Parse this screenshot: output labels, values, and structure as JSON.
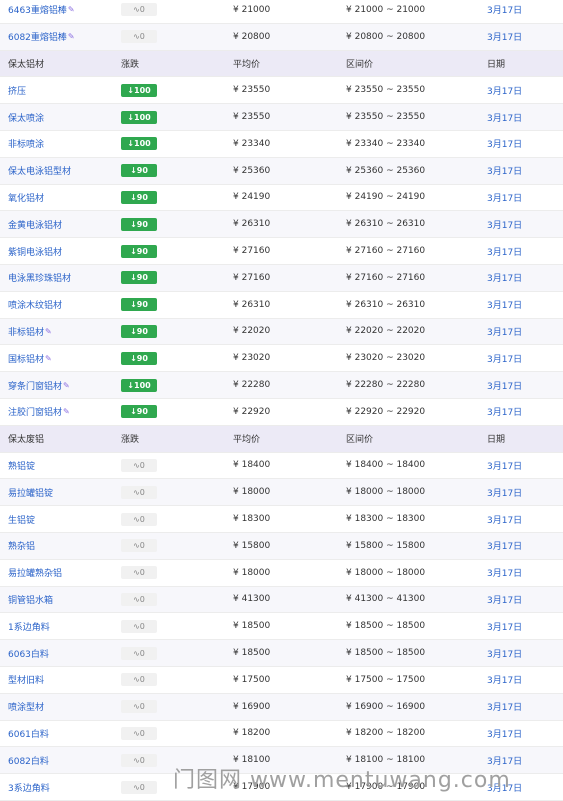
{
  "groups": [
    {
      "header": null,
      "rows": [
        {
          "name": "6463重熔铝棒",
          "pen": true,
          "change": "0",
          "dir": "flat",
          "avg": "¥ 21000",
          "range": "¥ 21000 ~ 21000",
          "date": "3月17日"
        },
        {
          "name": "6082重熔铝棒",
          "pen": true,
          "change": "0",
          "dir": "flat",
          "avg": "¥ 20800",
          "range": "¥ 20800 ~ 20800",
          "date": "3月17日"
        }
      ]
    },
    {
      "header": {
        "name": "保太铝材",
        "change": "涨跌",
        "avg": "平均价",
        "range": "区间价",
        "date": "日期"
      },
      "rows": [
        {
          "name": "挤压",
          "change": "100",
          "dir": "down",
          "avg": "¥ 23550",
          "range": "¥ 23550 ~ 23550",
          "date": "3月17日"
        },
        {
          "name": "保太喷涂",
          "change": "100",
          "dir": "down",
          "avg": "¥ 23550",
          "range": "¥ 23550 ~ 23550",
          "date": "3月17日"
        },
        {
          "name": "非标喷涂",
          "change": "100",
          "dir": "down",
          "avg": "¥ 23340",
          "range": "¥ 23340 ~ 23340",
          "date": "3月17日"
        },
        {
          "name": "保太电泳铝型材",
          "change": "90",
          "dir": "down",
          "avg": "¥ 25360",
          "range": "¥ 25360 ~ 25360",
          "date": "3月17日"
        },
        {
          "name": "氧化铝材",
          "change": "90",
          "dir": "down",
          "avg": "¥ 24190",
          "range": "¥ 24190 ~ 24190",
          "date": "3月17日"
        },
        {
          "name": "金黄电泳铝材",
          "change": "90",
          "dir": "down",
          "avg": "¥ 26310",
          "range": "¥ 26310 ~ 26310",
          "date": "3月17日"
        },
        {
          "name": "紫铜电泳铝材",
          "change": "90",
          "dir": "down",
          "avg": "¥ 27160",
          "range": "¥ 27160 ~ 27160",
          "date": "3月17日"
        },
        {
          "name": "电泳黑珍珠铝材",
          "change": "90",
          "dir": "down",
          "avg": "¥ 27160",
          "range": "¥ 27160 ~ 27160",
          "date": "3月17日"
        },
        {
          "name": "喷涂木纹铝材",
          "change": "90",
          "dir": "down",
          "avg": "¥ 26310",
          "range": "¥ 26310 ~ 26310",
          "date": "3月17日"
        },
        {
          "name": "非标铝材",
          "pen": true,
          "change": "90",
          "dir": "down",
          "avg": "¥ 22020",
          "range": "¥ 22020 ~ 22020",
          "date": "3月17日"
        },
        {
          "name": "国标铝材",
          "pen": true,
          "change": "90",
          "dir": "down",
          "avg": "¥ 23020",
          "range": "¥ 23020 ~ 23020",
          "date": "3月17日"
        },
        {
          "name": "穿条门窗铝材",
          "pen": true,
          "change": "100",
          "dir": "down",
          "avg": "¥ 22280",
          "range": "¥ 22280 ~ 22280",
          "date": "3月17日"
        },
        {
          "name": "注胶门窗铝材",
          "pen": true,
          "change": "90",
          "dir": "down",
          "avg": "¥ 22920",
          "range": "¥ 22920 ~ 22920",
          "date": "3月17日"
        }
      ]
    },
    {
      "header": {
        "name": "保太废铝",
        "change": "涨跌",
        "avg": "平均价",
        "range": "区间价",
        "date": "日期"
      },
      "rows": [
        {
          "name": "熟铝锭",
          "change": "0",
          "dir": "flat",
          "avg": "¥ 18400",
          "range": "¥ 18400 ~ 18400",
          "date": "3月17日"
        },
        {
          "name": "易拉罐铝锭",
          "change": "0",
          "dir": "flat",
          "avg": "¥ 18000",
          "range": "¥ 18000 ~ 18000",
          "date": "3月17日"
        },
        {
          "name": "生铝锭",
          "change": "0",
          "dir": "flat",
          "avg": "¥ 18300",
          "range": "¥ 18300 ~ 18300",
          "date": "3月17日"
        },
        {
          "name": "熟杂铝",
          "change": "0",
          "dir": "flat",
          "avg": "¥ 15800",
          "range": "¥ 15800 ~ 15800",
          "date": "3月17日"
        },
        {
          "name": "易拉罐熟杂铝",
          "change": "0",
          "dir": "flat",
          "avg": "¥ 18000",
          "range": "¥ 18000 ~ 18000",
          "date": "3月17日"
        },
        {
          "name": "铜管铝水箱",
          "change": "0",
          "dir": "flat",
          "avg": "¥ 41300",
          "range": "¥ 41300 ~ 41300",
          "date": "3月17日"
        },
        {
          "name": "1系边角料",
          "change": "0",
          "dir": "flat",
          "avg": "¥ 18500",
          "range": "¥ 18500 ~ 18500",
          "date": "3月17日"
        },
        {
          "name": "6063白料",
          "change": "0",
          "dir": "flat",
          "avg": "¥ 18500",
          "range": "¥ 18500 ~ 18500",
          "date": "3月17日"
        },
        {
          "name": "型材旧料",
          "change": "0",
          "dir": "flat",
          "avg": "¥ 17500",
          "range": "¥ 17500 ~ 17500",
          "date": "3月17日"
        },
        {
          "name": "喷涂型材",
          "change": "0",
          "dir": "flat",
          "avg": "¥ 16900",
          "range": "¥ 16900 ~ 16900",
          "date": "3月17日"
        },
        {
          "name": "6061白料",
          "change": "0",
          "dir": "flat",
          "avg": "¥ 18200",
          "range": "¥ 18200 ~ 18200",
          "date": "3月17日"
        },
        {
          "name": "6082白料",
          "change": "0",
          "dir": "flat",
          "avg": "¥ 18100",
          "range": "¥ 18100 ~ 18100",
          "date": "3月17日"
        },
        {
          "name": "3系边角料",
          "change": "0",
          "dir": "flat",
          "avg": "¥ 17900",
          "range": "¥ 17900 ~ 17900",
          "date": "3月17日"
        }
      ]
    }
  ],
  "icons": {
    "down": "arrow-down-icon",
    "flat": "flat-trend-icon",
    "pen": "edit-pen-icon"
  },
  "colors": {
    "link": "#2b63c9",
    "down": "#2fa84f",
    "header_bg": "#eceaf6"
  },
  "watermark": "门图网 www.mentuwang.com"
}
